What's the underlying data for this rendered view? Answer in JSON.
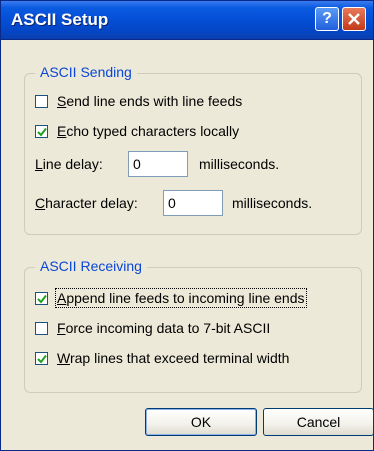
{
  "window": {
    "title": "ASCII Setup"
  },
  "ascii_sending": {
    "legend": "ASCII Sending",
    "send_line_ends": {
      "label": "Send line ends with line feeds",
      "underline": "S",
      "rest": "end line ends with line feeds",
      "checked": false
    },
    "echo_local": {
      "label": "Echo typed characters locally",
      "underline": "E",
      "rest": "cho typed characters locally",
      "checked": true
    },
    "line_delay": {
      "underline": "L",
      "rest": "ine delay:",
      "value": "0",
      "unit": "milliseconds."
    },
    "char_delay": {
      "underline": "C",
      "rest": "haracter delay:",
      "value": "0",
      "unit": "milliseconds."
    }
  },
  "ascii_receiving": {
    "legend": "ASCII Receiving",
    "append_lf": {
      "label": "Append line feeds to incoming line ends",
      "underline": "A",
      "rest": "ppend line feeds to incoming line ends",
      "checked": true
    },
    "force_7bit": {
      "label": "Force incoming data to 7-bit ASCII",
      "underline": "F",
      "rest": "orce incoming data to 7-bit ASCII",
      "checked": false
    },
    "wrap_lines": {
      "label": "Wrap lines that exceed terminal width",
      "underline": "W",
      "rest": "rap lines that exceed terminal width",
      "checked": true
    }
  },
  "buttons": {
    "ok": "OK",
    "cancel": "Cancel"
  },
  "colors": {
    "title_bar": "#0550d8",
    "dialog_bg": "#ece9d8",
    "legend_text": "#0a46d6",
    "check_green": "#21a121"
  }
}
